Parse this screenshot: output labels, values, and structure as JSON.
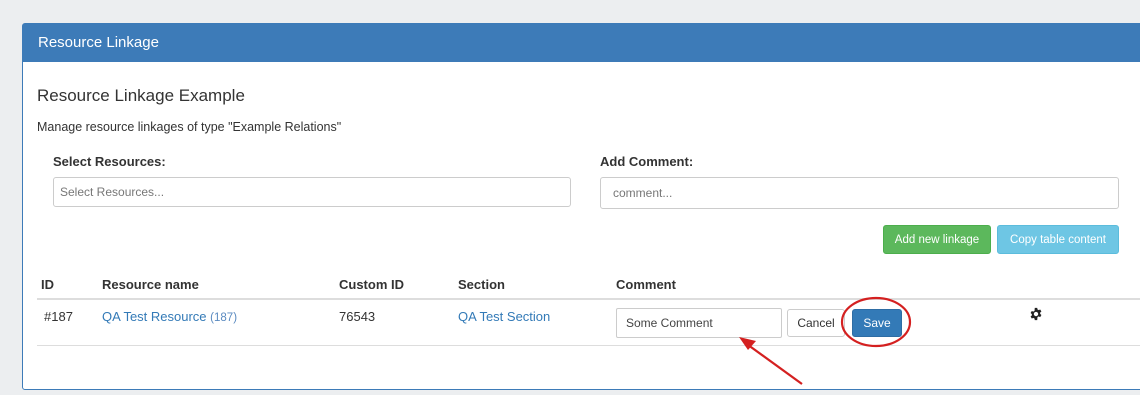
{
  "panel": {
    "title": "Resource Linkage"
  },
  "content": {
    "subtitle": "Resource Linkage Example",
    "description": "Manage resource linkages of type \"Example Relations\""
  },
  "form": {
    "resources_label": "Select Resources:",
    "resources_placeholder": "Select Resources...",
    "comment_label": "Add Comment:",
    "comment_placeholder": "comment..."
  },
  "actions": {
    "add_label": "Add new linkage",
    "copy_label": "Copy table content"
  },
  "table": {
    "headers": [
      "ID",
      "Resource name",
      "Custom ID",
      "Section",
      "Comment"
    ],
    "row": {
      "id": "#187",
      "resource_name": "QA Test Resource",
      "resource_sub_id": "(187)",
      "custom_id": "76543",
      "section": "QA Test Section",
      "comment_value": "Some Comment",
      "cancel_label": "Cancel",
      "save_label": "Save",
      "settings_icon": "gear-icon"
    }
  },
  "annotation_colors": {
    "highlight": "#d42020"
  }
}
